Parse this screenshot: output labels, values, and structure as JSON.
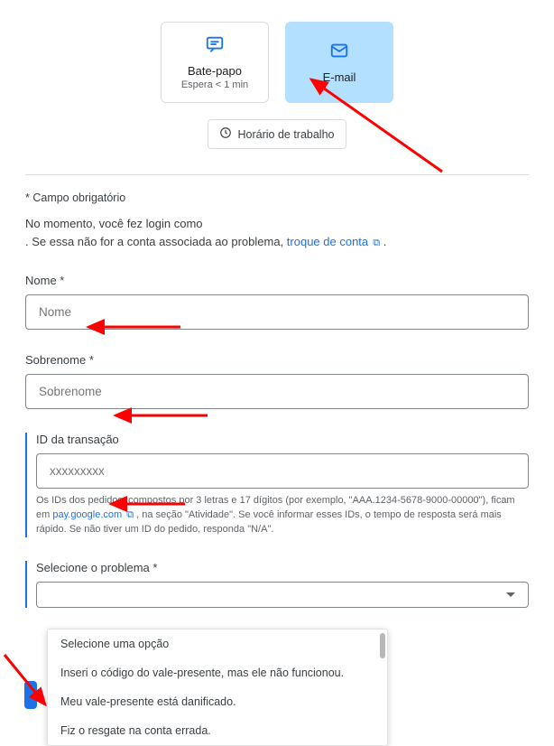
{
  "cards": {
    "chat": {
      "title": "Bate-papo",
      "sub": "Espera < 1 min"
    },
    "email": {
      "title": "E-mail"
    }
  },
  "hours_button": "Horário de trabalho",
  "required_note": "* Campo obrigatório",
  "login_line1": "No momento, você fez login como",
  "login_line2a": ". Se essa não for a conta associada ao problema, ",
  "switch_account": "troque de conta",
  "login_line2b": " .",
  "fields": {
    "nome": {
      "label": "Nome *",
      "placeholder": "Nome"
    },
    "sobrenome": {
      "label": "Sobrenome *",
      "placeholder": "Sobrenome"
    },
    "transacao": {
      "label": "ID da transação",
      "placeholder": "xxxxxxxxx"
    }
  },
  "help": {
    "p1a": "Os IDs dos pedidos, compostos por 3 letras e 17 dígitos (por exemplo, \"AAA.1234-5678-9000-00000\"), ficam em ",
    "link": "pay.google.com",
    "p1b": " , na seção \"Atividade\". Se você informar esses IDs, o tempo de resposta será mais rápido. Se não tiver um ID do pedido, responda \"N/A\"."
  },
  "select": {
    "label": "Selecione o problema *"
  },
  "dropdown": {
    "o1": "Selecione uma opção",
    "o2": "Inseri o código do vale-presente, mas ele não funcionou.",
    "o3": "Meu vale-presente está danificado.",
    "o4": "Fiz o resgate na conta errada."
  }
}
